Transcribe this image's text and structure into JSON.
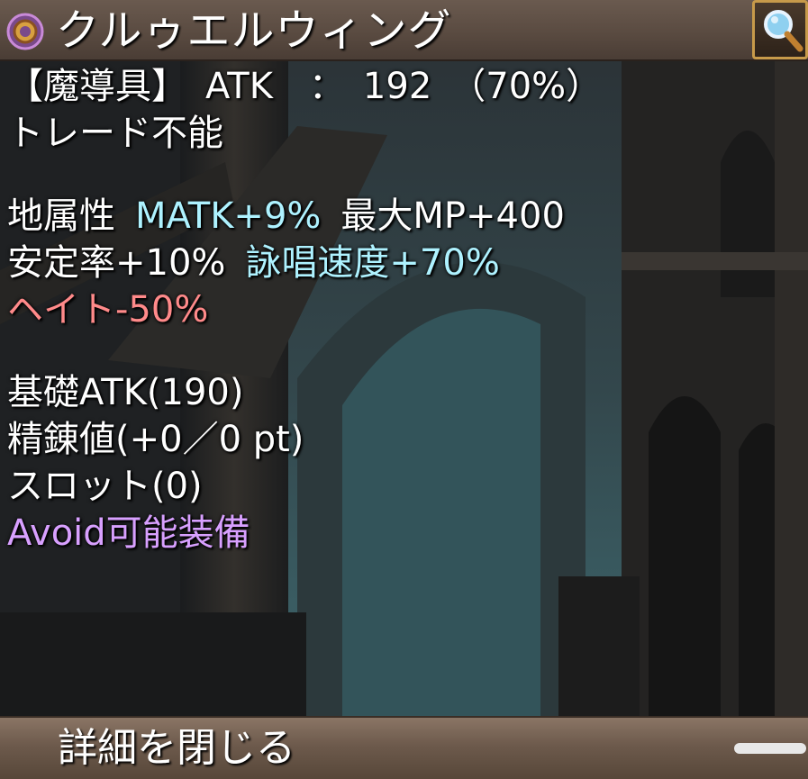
{
  "header": {
    "title": "クルゥエルウィング",
    "item_icon": "ring-icon",
    "search_icon": "magnifier-icon"
  },
  "item": {
    "type_line": "【魔導具】　ATK　：　192　（70%）",
    "trade_status": "トレード不能",
    "attributes": {
      "element": "地属性",
      "matk": "MATK+9%",
      "max_mp": "最大MP+400",
      "stability": "安定率+10%",
      "cast_speed": "詠唱速度+70%",
      "hate": "ヘイト-50%"
    },
    "base_atk": "基礎ATK(190)",
    "refine": "精錬値(+0／0 pt)",
    "slots": "スロット(0)",
    "avoid": "Avoid可能装備"
  },
  "footer": {
    "close_label": "詳細を閉じる"
  },
  "colors": {
    "cyan_stat": "#aef2ff",
    "negative_stat": "#ff8a8a",
    "avoid_text": "#d8a0ff",
    "title_bar": "#5a4b41",
    "footer_bar": "#6d5a4c"
  }
}
